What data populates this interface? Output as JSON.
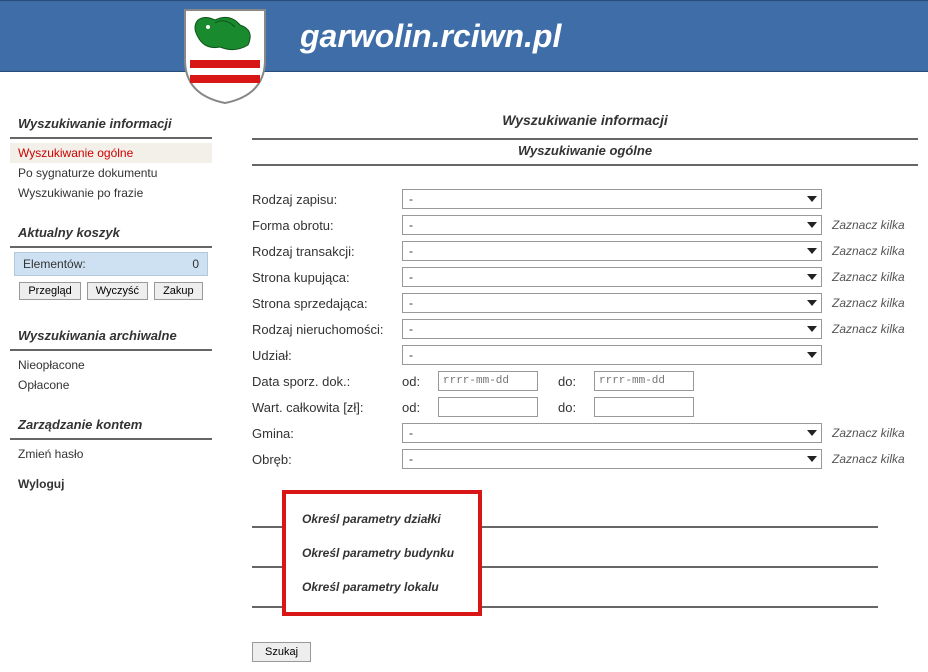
{
  "header": {
    "title": "garwolin.rciwn.pl"
  },
  "sidebar": {
    "search_heading": "Wyszukiwanie informacji",
    "search_items": [
      "Wyszukiwanie ogólne",
      "Po sygnaturze dokumentu",
      "Wyszukiwanie po frazie"
    ],
    "basket_heading": "Aktualny koszyk",
    "basket_label": "Elementów:",
    "basket_count": "0",
    "btn_preview": "Przegląd",
    "btn_clear": "Wyczyść",
    "btn_buy": "Zakup",
    "archive_heading": "Wyszukiwania archiwalne",
    "archive_items": [
      "Nieopłacone",
      "Opłacone"
    ],
    "account_heading": "Zarządzanie kontem",
    "account_change_pw": "Zmień hasło",
    "account_logout": "Wyloguj"
  },
  "main": {
    "title": "Wyszukiwanie informacji",
    "subtitle": "Wyszukiwanie ogólne",
    "labels": {
      "rodzaj_zapisu": "Rodzaj zapisu:",
      "forma_obrotu": "Forma obrotu:",
      "rodzaj_transakcji": "Rodzaj transakcji:",
      "strona_kupujaca": "Strona kupująca:",
      "strona_sprzedajaca": "Strona sprzedająca:",
      "rodzaj_nieruchomosci": "Rodzaj nieruchomości:",
      "udzial": "Udział:",
      "data_sporz": "Data sporz. dok.:",
      "wart_calkowita": "Wart. całkowita [zł]:",
      "gmina": "Gmina:",
      "obreb": "Obręb:",
      "od": "od:",
      "do": "do:"
    },
    "select_value": "-",
    "zaznacz_kilka": "Zaznacz kilka",
    "date_placeholder": "rrrr-mm-dd",
    "params": [
      "Określ parametry działki",
      "Określ parametry budynku",
      "Określ parametry lokalu"
    ],
    "search_btn": "Szukaj"
  }
}
